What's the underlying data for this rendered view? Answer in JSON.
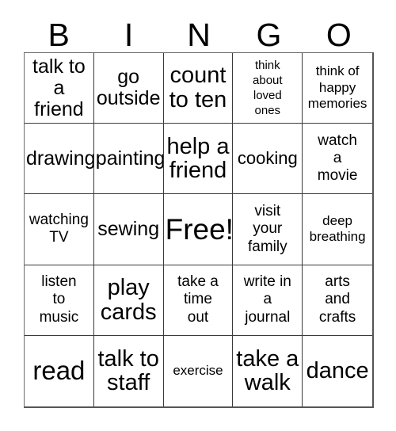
{
  "card": {
    "title": "BINGO",
    "header_letters": [
      "B",
      "I",
      "N",
      "G",
      "O"
    ],
    "columns": 5,
    "rows": 5,
    "free_space_label": "Free!",
    "free_space_position": "center",
    "border_color": "#3a3a3a",
    "background_color": "#ffffff",
    "text_color": "#000000",
    "cells": [
      {
        "text": "talk to\na friend",
        "size": "fs-xl"
      },
      {
        "text": "go\noutside",
        "size": "fs-xl"
      },
      {
        "text": "count\nto ten",
        "size": "fs-2xl"
      },
      {
        "text": "think\nabout\nloved\nones",
        "size": "fs-xs"
      },
      {
        "text": "think of\nhappy\nmemories",
        "size": "fs-sm"
      },
      {
        "text": "drawing",
        "size": "fs-xl"
      },
      {
        "text": "painting",
        "size": "fs-xl"
      },
      {
        "text": "help a\nfriend",
        "size": "fs-2xl"
      },
      {
        "text": "cooking",
        "size": "fs-lg"
      },
      {
        "text": "watch\na\nmovie",
        "size": "fs-md"
      },
      {
        "text": "watching\nTV",
        "size": "fs-md"
      },
      {
        "text": "sewing",
        "size": "fs-xl"
      },
      {
        "text": "Free!",
        "size": "fs-4xl"
      },
      {
        "text": "visit\nyour\nfamily",
        "size": "fs-md"
      },
      {
        "text": "deep\nbreathing",
        "size": "fs-sm"
      },
      {
        "text": "listen\nto\nmusic",
        "size": "fs-md"
      },
      {
        "text": "play\ncards",
        "size": "fs-2xl"
      },
      {
        "text": "take a\ntime\nout",
        "size": "fs-md"
      },
      {
        "text": "write in\na\njournal",
        "size": "fs-md"
      },
      {
        "text": "arts\nand\ncrafts",
        "size": "fs-md"
      },
      {
        "text": "read",
        "size": "fs-3xl"
      },
      {
        "text": "talk to\nstaff",
        "size": "fs-2xl"
      },
      {
        "text": "exercise",
        "size": "fs-sm"
      },
      {
        "text": "take a\nwalk",
        "size": "fs-2xl"
      },
      {
        "text": "dance",
        "size": "fs-2xl"
      }
    ]
  }
}
